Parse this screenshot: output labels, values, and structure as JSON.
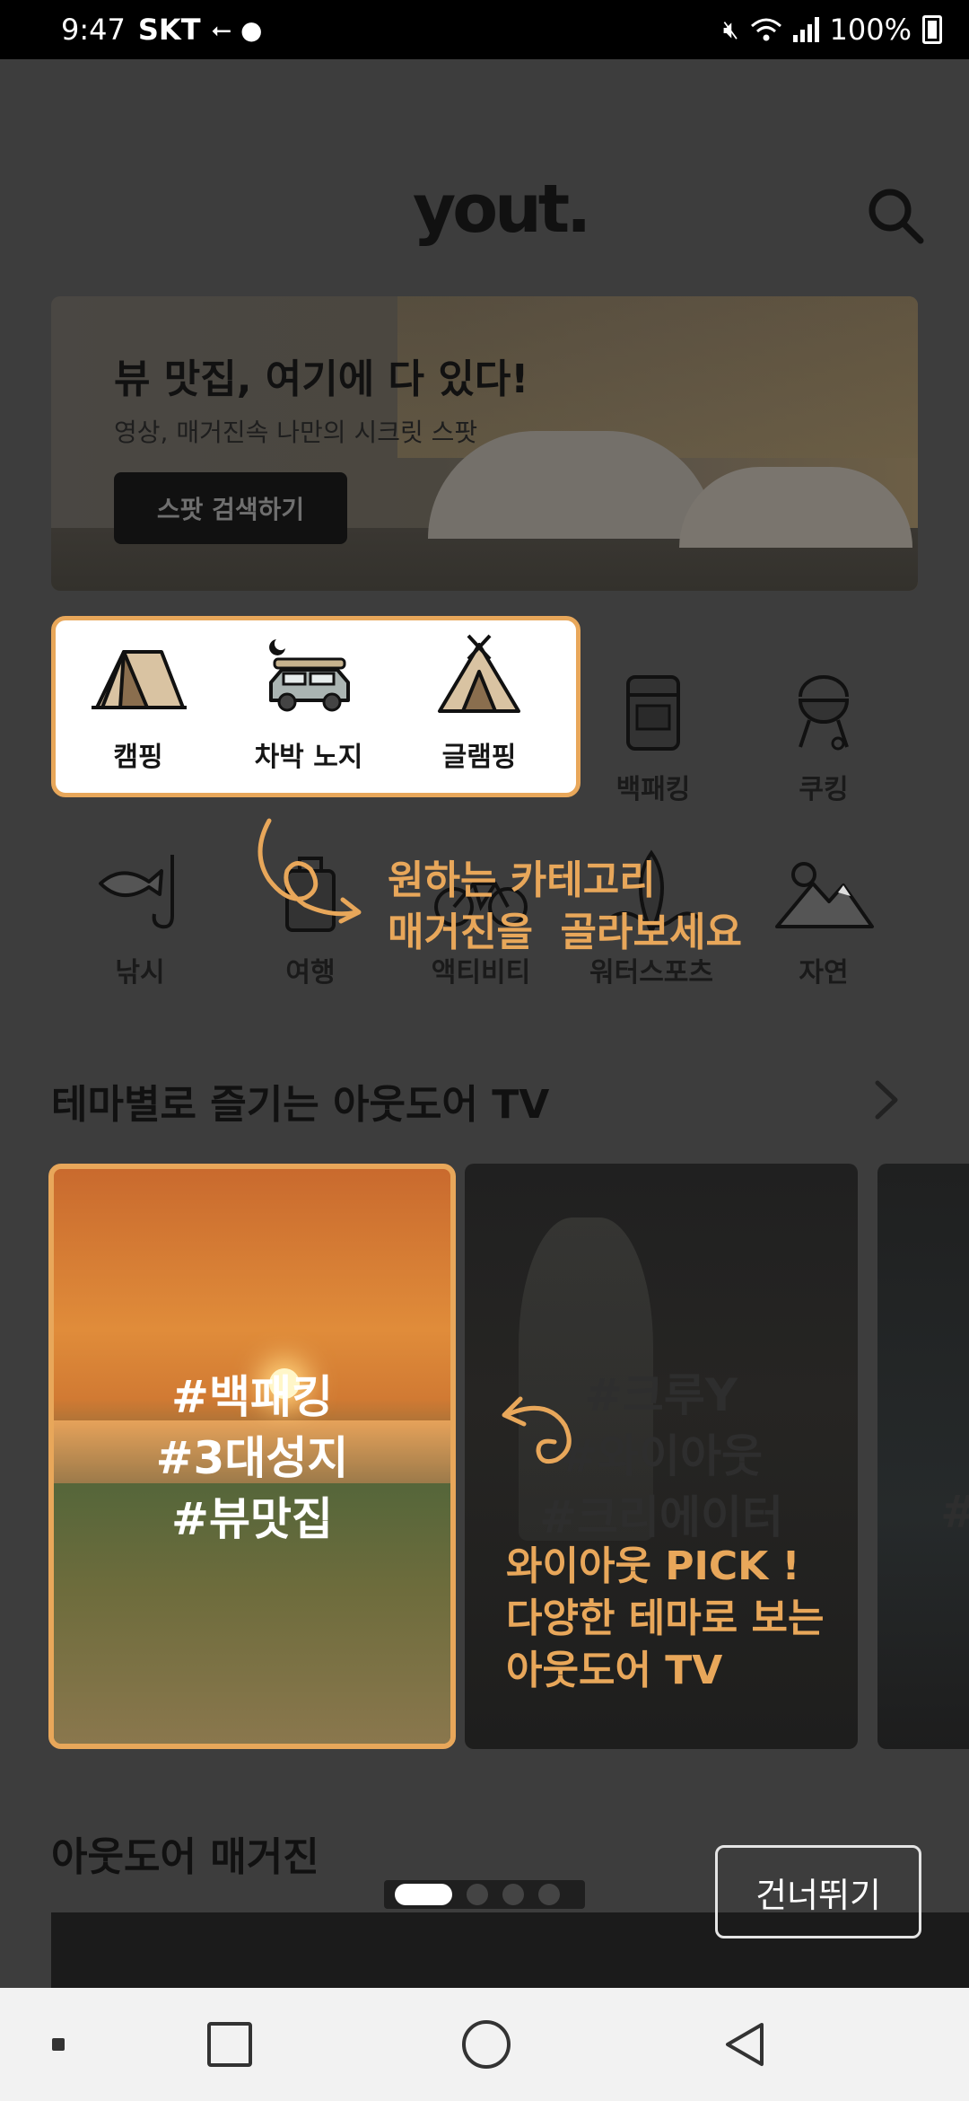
{
  "status_bar": {
    "time": "9:47",
    "carrier": "SKT",
    "battery": "100%"
  },
  "header": {
    "logo": "yout."
  },
  "banner": {
    "title": "뷰 맛집, 여기에 다 있다!",
    "subtitle": "영상, 매거진속 나만의 시크릿 스팟",
    "button": "스팟 검색하기"
  },
  "categories": [
    {
      "label": "캠핑",
      "icon": "tent-icon"
    },
    {
      "label": "차박 노지",
      "icon": "car-camping-icon"
    },
    {
      "label": "글램핑",
      "icon": "teepee-icon"
    },
    {
      "label": "백패킹",
      "icon": "backpack-icon"
    },
    {
      "label": "쿠킹",
      "icon": "grill-icon"
    },
    {
      "label": "낚시",
      "icon": "fishing-icon"
    },
    {
      "label": "여행",
      "icon": "luggage-icon"
    },
    {
      "label": "액티비티",
      "icon": "bike-icon"
    },
    {
      "label": "워터스포츠",
      "icon": "surf-icon"
    },
    {
      "label": "자연",
      "icon": "mountain-icon"
    }
  ],
  "tips": {
    "category_tip": [
      "원하는 카테고리",
      "매거진을  골라보세요"
    ],
    "tv_tip": [
      "와이아웃 PICK !",
      "다양한 테마로 보는",
      "아웃도어 TV"
    ]
  },
  "tv_section": {
    "title": "테마별로 즐기는 아웃도어 TV",
    "cards": [
      {
        "tags": [
          "#백패킹",
          "#3대성지",
          "#뷰맛집"
        ]
      },
      {
        "tags": [
          "#크루Y",
          "#와이아웃",
          "#크리에이터"
        ]
      },
      {
        "tags": [
          "#"
        ]
      }
    ]
  },
  "magazine_section": {
    "title": "아웃도어 매거진"
  },
  "onboarding": {
    "skip": "건너뛰기",
    "pages": 4,
    "current": 1
  },
  "colors": {
    "accent": "#e8a75a",
    "overlay": "#3d3d3d"
  }
}
